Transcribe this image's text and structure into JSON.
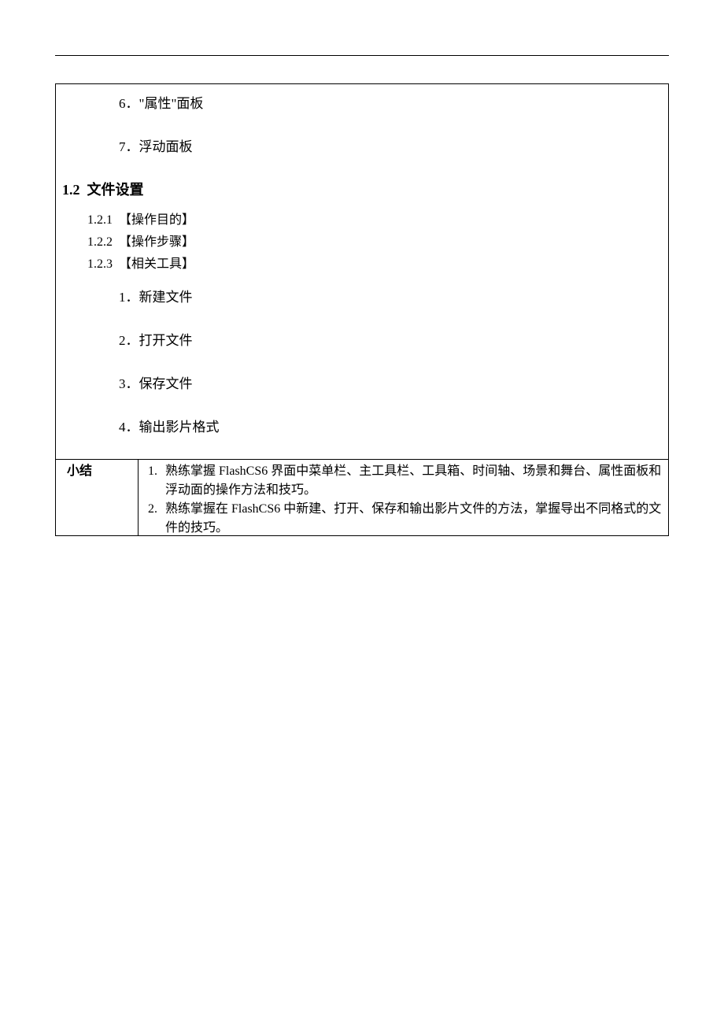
{
  "main": {
    "topItems": [
      "6．\"属性\"面板",
      "7．浮动面板"
    ],
    "section": {
      "number": "1.2",
      "title": "文件设置"
    },
    "subs": [
      {
        "num": "1.2.1",
        "label": "【操作目的】"
      },
      {
        "num": "1.2.2",
        "label": "【操作步骤】"
      },
      {
        "num": "1.2.3",
        "label": "【相关工具】"
      }
    ],
    "steps": [
      "1．新建文件",
      "2．打开文件",
      "3．保存文件",
      "4．输出影片格式"
    ]
  },
  "summary": {
    "label": "小结",
    "items": [
      "熟练掌握 FlashCS6 界面中菜单栏、主工具栏、工具箱、时间轴、场景和舞台、属性面板和浮动面的操作方法和技巧。",
      "熟练掌握在 FlashCS6 中新建、打开、保存和输出影片文件的方法，掌握导出不同格式的文件的技巧。"
    ]
  }
}
